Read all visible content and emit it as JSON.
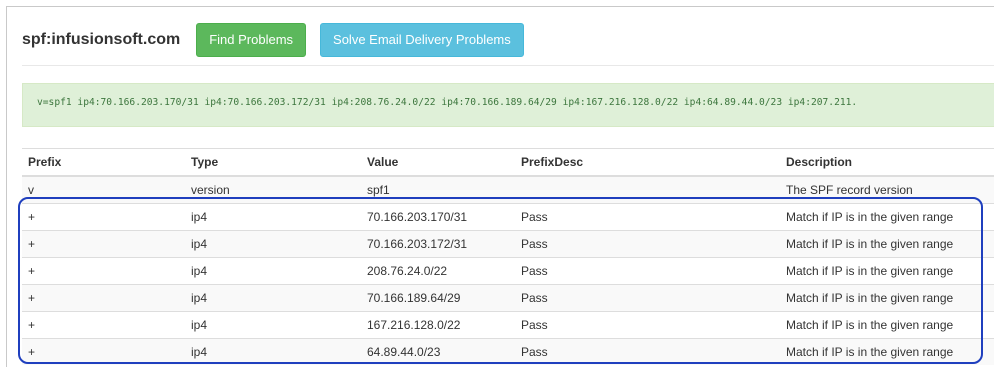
{
  "header": {
    "title": "spf:infusionsoft.com",
    "find_problems_label": "Find Problems",
    "solve_email_label": "Solve Email Delivery Problems"
  },
  "record": {
    "text": "v=spf1 ip4:70.166.203.170/31 ip4:70.166.203.172/31 ip4:208.76.24.0/22 ip4:70.166.189.64/29 ip4:167.216.128.0/22 ip4:64.89.44.0/23 ip4:207.211."
  },
  "table": {
    "headers": {
      "prefix": "Prefix",
      "type": "Type",
      "value": "Value",
      "prefix_desc": "PrefixDesc",
      "description": "Description"
    },
    "rows": [
      {
        "prefix": "v",
        "type": "version",
        "value": "spf1",
        "prefix_desc": "",
        "description": "The SPF record version"
      },
      {
        "prefix": "+",
        "type": "ip4",
        "value": "70.166.203.170/31",
        "prefix_desc": "Pass",
        "description": "Match if IP is in the given range"
      },
      {
        "prefix": "+",
        "type": "ip4",
        "value": "70.166.203.172/31",
        "prefix_desc": "Pass",
        "description": "Match if IP is in the given range"
      },
      {
        "prefix": "+",
        "type": "ip4",
        "value": "208.76.24.0/22",
        "prefix_desc": "Pass",
        "description": "Match if IP is in the given range"
      },
      {
        "prefix": "+",
        "type": "ip4",
        "value": "70.166.189.64/29",
        "prefix_desc": "Pass",
        "description": "Match if IP is in the given range"
      },
      {
        "prefix": "+",
        "type": "ip4",
        "value": "167.216.128.0/22",
        "prefix_desc": "Pass",
        "description": "Match if IP is in the given range"
      },
      {
        "prefix": "+",
        "type": "ip4",
        "value": "64.89.44.0/23",
        "prefix_desc": "Pass",
        "description": "Match if IP is in the given range"
      }
    ]
  },
  "colors": {
    "success_button": "#5cb85c",
    "info_button": "#5bc0de",
    "record_bg": "#dff0d8",
    "record_text": "#3c763d",
    "highlight_border": "#1f3fbe"
  }
}
